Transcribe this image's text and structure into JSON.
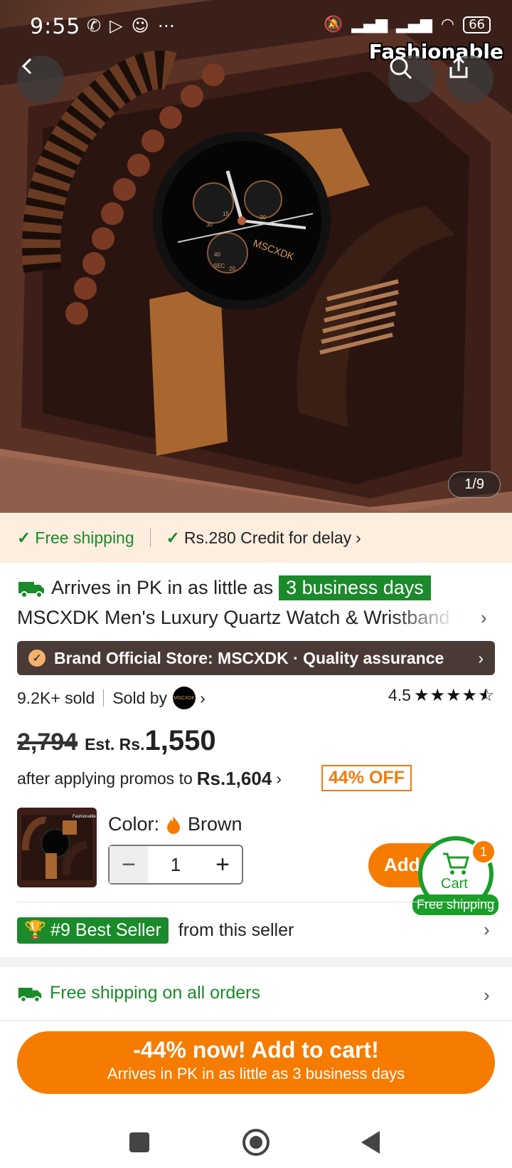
{
  "statusbar": {
    "time": "9:55",
    "battery": "66",
    "icons": [
      "whatsapp-icon",
      "play-icon",
      "snapchat-icon",
      "more-dots"
    ]
  },
  "hero": {
    "watermark": "Fashionable",
    "counter": "1/9",
    "watch_brand": "MSCXDK",
    "dial_labels": [
      "30",
      "15",
      "40",
      "SEC",
      "20",
      "20"
    ]
  },
  "shipping_bar": {
    "free_shipping": "Free shipping",
    "credit": "Rs.280 Credit for delay"
  },
  "delivery": {
    "prefix": "Arrives in PK in as little as",
    "days": "3 business days"
  },
  "product": {
    "title": "MSCXDK Men's Luxury Quartz Watch & Wristband Set"
  },
  "store": {
    "label": "Brand Official Store: MSCXDK · Quality assurance"
  },
  "stats": {
    "sold": "9.2K+ sold",
    "sold_by": "Sold by",
    "seller_logo_text": "MSCXDK",
    "rating": "4.5",
    "rating_value": 4.5
  },
  "pricing": {
    "original": "2,794",
    "est_label": "Est. Rs.",
    "price": "1,550",
    "promo_text": "after applying promos to",
    "promo_price": "Rs.1,604",
    "discount": "44% OFF"
  },
  "variant": {
    "color_label": "Color:",
    "color_value": "Brown",
    "quantity": "1",
    "thumb_watermark": "Fashionable"
  },
  "cart": {
    "add_label": "Add to cart",
    "badge_count": "1",
    "cart_label": "Cart",
    "free_label": "Free shipping"
  },
  "seller_rank": {
    "badge": "#9 Best Seller",
    "suffix": "from this seller"
  },
  "shipping_all": {
    "label": "Free shipping on all orders"
  },
  "cta": {
    "line1": "-44% now! Add to cart!",
    "line2": "Arrives in PK in as little as 3 business days"
  },
  "colors": {
    "accent_orange": "#f57c00",
    "green": "#1a8a2a",
    "store_bar": "#4a3a36"
  }
}
